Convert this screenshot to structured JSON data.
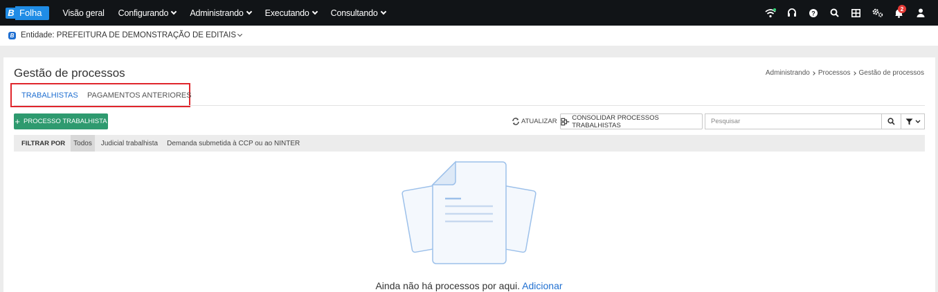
{
  "brand": {
    "letter": "B",
    "name": "Folha",
    "color": "#1f8ce6"
  },
  "nav": {
    "items": [
      {
        "label": "Visão geral",
        "dropdown": false
      },
      {
        "label": "Configurando",
        "dropdown": true
      },
      {
        "label": "Administrando",
        "dropdown": true
      },
      {
        "label": "Executando",
        "dropdown": true
      },
      {
        "label": "Consultando",
        "dropdown": true
      }
    ],
    "icons": [
      "wifi-icon",
      "headset-icon",
      "help-icon",
      "search-icon",
      "apps-grid-icon",
      "settings-icon",
      "notifications-icon",
      "user-icon"
    ],
    "notification_count": "2"
  },
  "entity": {
    "letter": "B",
    "label": "Entidade: PREFEITURA DE DEMONSTRAÇÃO DE EDITAIS"
  },
  "page": {
    "title": "Gestão de processos",
    "breadcrumb": [
      "Administrando",
      "Processos",
      "Gestão de processos"
    ]
  },
  "tabs": [
    {
      "label": "TRABALHISTAS",
      "active": true
    },
    {
      "label": "PAGAMENTOS ANTERIORES",
      "active": false
    }
  ],
  "toolbar": {
    "add_label": "PROCESSO TRABALHISTA",
    "refresh_label": "ATUALIZAR",
    "consolidar_label": "CONSOLIDAR PROCESSOS TRABALHISTAS",
    "search_placeholder": "Pesquisar"
  },
  "filter": {
    "label": "FILTRAR POR",
    "options": [
      {
        "label": "Todos",
        "active": true
      },
      {
        "label": "Judicial trabalhista",
        "active": false
      },
      {
        "label": "Demanda submetida à CCP ou ao NINTER",
        "active": false
      }
    ]
  },
  "empty_state": {
    "text": "Ainda não há processos por aqui. ",
    "link": "Adicionar"
  },
  "colors": {
    "accent": "#1f6fd1",
    "green": "#2e9a6f",
    "highlight": "#e0252b",
    "topbar": "#111417"
  }
}
